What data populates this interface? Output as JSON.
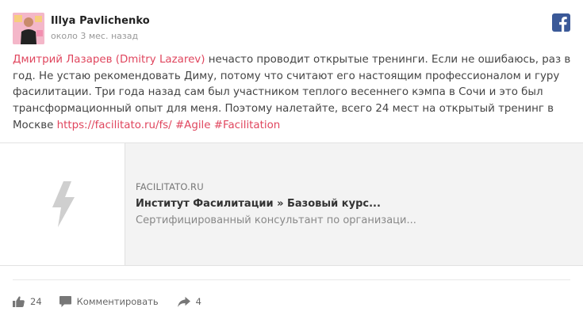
{
  "author": {
    "name": "Illya Pavlichenko",
    "time": "около 3 мес. назад"
  },
  "social_icon": "facebook-icon",
  "colors": {
    "link": "#e0465e",
    "facebook": "#3b5998",
    "muted": "#999999"
  },
  "post": {
    "mention": "Дмитрий Лазарев (Dmitry Lazarev)",
    "text": " нечасто проводит открытые тренинги. Если не ошибаюсь, раз в год. Не устаю рекомендовать Диму, потому что считают его настоящим профессионалом и гуру фасилитации. Три года назад сам был участником теплого весеннего кэмпа в Сочи и это был трансформационный опыт для меня. Поэтому налетайте, всего 24 мест на открытый тренинг в Москве ",
    "url": "https://facilitato.ru/fs/",
    "tag_agile": "#Agile",
    "tag_facilitation": "#Facilitation"
  },
  "link_preview": {
    "domain": "FACILITATO.RU",
    "title": "Институт Фасилитации » Базовый курс...",
    "description": "Сертифицированный консультант по организаци...",
    "thumbnail_icon": "lightning-icon"
  },
  "actions": {
    "likes": "24",
    "comment_label": "Комментировать",
    "shares": "4"
  }
}
